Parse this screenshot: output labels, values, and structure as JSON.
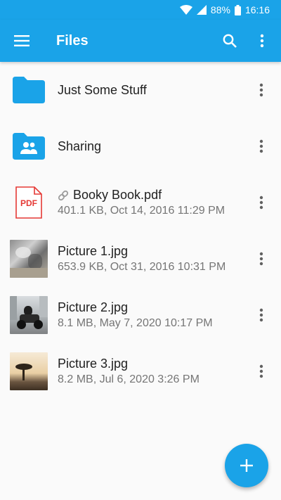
{
  "status_bar": {
    "battery": "88%",
    "time": "16:16"
  },
  "app_bar": {
    "title": "Files",
    "menu_icon": "hamburger-menu-icon",
    "search_icon": "search-icon",
    "overflow_icon": "more-vert-icon"
  },
  "colors": {
    "accent": "#1aa3e8",
    "pdf_red": "#e53935",
    "text_primary": "#212121",
    "text_secondary": "#757575"
  },
  "files": [
    {
      "name": "Just Some Stuff",
      "meta": "",
      "type": "folder",
      "icon": "folder-icon"
    },
    {
      "name": "Sharing",
      "meta": "",
      "type": "shared-folder",
      "icon": "shared-folder-icon"
    },
    {
      "name": "Booky Book.pdf",
      "meta": "401.1 KB, Oct 14, 2016 11:29 PM",
      "type": "pdf",
      "icon": "pdf-icon",
      "pdf_label": "PDF",
      "linked": true
    },
    {
      "name": "Picture 1.jpg",
      "meta": "653.9 KB, Oct 31, 2016 10:31 PM",
      "type": "image",
      "icon": "image-thumbnail"
    },
    {
      "name": "Picture 2.jpg",
      "meta": "8.1 MB, May 7, 2020 10:17 PM",
      "type": "image",
      "icon": "image-thumbnail"
    },
    {
      "name": "Picture 3.jpg",
      "meta": "8.2 MB, Jul 6, 2020 3:26 PM",
      "type": "image",
      "icon": "image-thumbnail"
    }
  ],
  "fab": {
    "icon": "plus-icon"
  }
}
